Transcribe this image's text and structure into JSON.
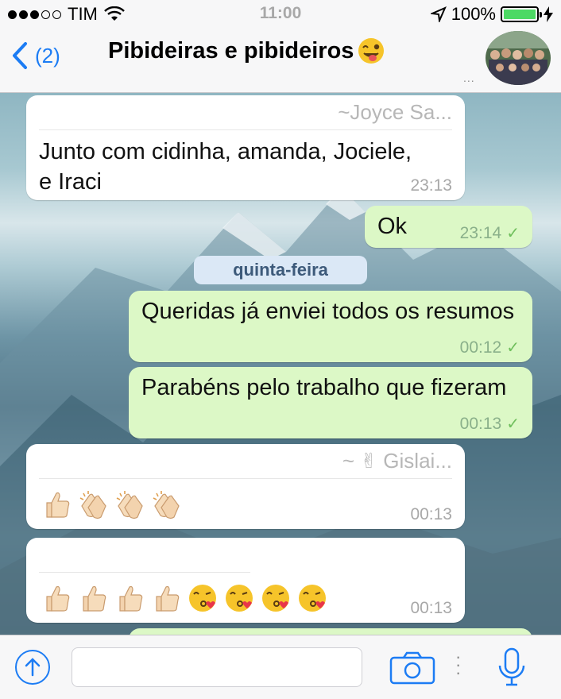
{
  "status_bar": {
    "carrier": "TIM",
    "time": "11:00",
    "battery_percent": "100%",
    "battery_level": 1.0
  },
  "nav": {
    "back_count": "(2)",
    "title": "Pibideiras e pibideiros",
    "title_emoji": "winking-face-with-tongue"
  },
  "chat": {
    "messages": [
      {
        "direction": "in",
        "sender": "~Joyce Sa...",
        "text": "Junto com cidinha, amanda, Jociele,  e Iraci",
        "time": "23:13"
      },
      {
        "direction": "out",
        "text": "Ok",
        "time": "23:14",
        "status": "delivered"
      },
      {
        "direction": "out",
        "text": "Queridas já enviei todos os resumos",
        "time": "00:12",
        "status": "delivered"
      },
      {
        "direction": "out",
        "text": "Parabéns pelo trabalho que fizeram",
        "time": "00:13",
        "status": "delivered"
      },
      {
        "direction": "in",
        "sender": "~ ✌ Gislai...",
        "emojis": [
          "thumbs-up",
          "clapping-hands",
          "clapping-hands",
          "clapping-hands"
        ],
        "time": "00:13"
      },
      {
        "direction": "in",
        "sender": "",
        "emojis": [
          "thumbs-up",
          "thumbs-up",
          "thumbs-up",
          "thumbs-up",
          "face-blowing-kiss",
          "face-blowing-kiss",
          "face-blowing-kiss",
          "face-blowing-kiss"
        ],
        "time": "00:13"
      }
    ],
    "day_separator": "quinta-feira"
  },
  "input_bar": {
    "placeholder": ""
  },
  "colors": {
    "accent": "#1c7cf4",
    "outgoing_bubble": "#dcf8c6",
    "incoming_bubble": "#ffffff",
    "read_tick": "#6fbf5c"
  }
}
